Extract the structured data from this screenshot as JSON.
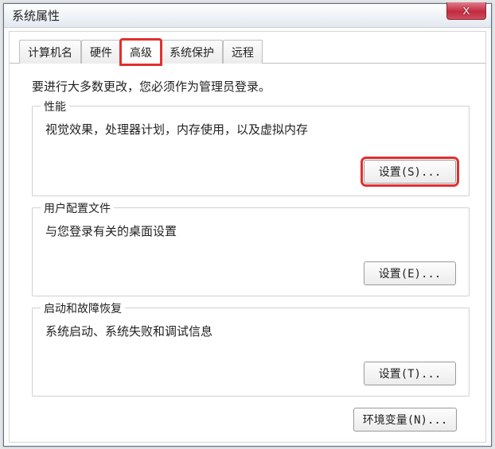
{
  "window": {
    "title": "系统属性",
    "close_glyph": "X"
  },
  "tabs": {
    "computer_name": "计算机名",
    "hardware": "硬件",
    "advanced": "高级",
    "system_protection": "系统保护",
    "remote": "远程"
  },
  "intro": "要进行大多数更改，您必须作为管理员登录。",
  "group_performance": {
    "title": "性能",
    "desc": "视觉效果，处理器计划，内存使用，以及虚拟内存",
    "button": "设置(S)..."
  },
  "group_user_profile": {
    "title": "用户配置文件",
    "desc": "与您登录有关的桌面设置",
    "button": "设置(E)..."
  },
  "group_startup": {
    "title": "启动和故障恢复",
    "desc": "系统启动、系统失败和调试信息",
    "button": "设置(T)..."
  },
  "env_button": "环境变量(N)..."
}
